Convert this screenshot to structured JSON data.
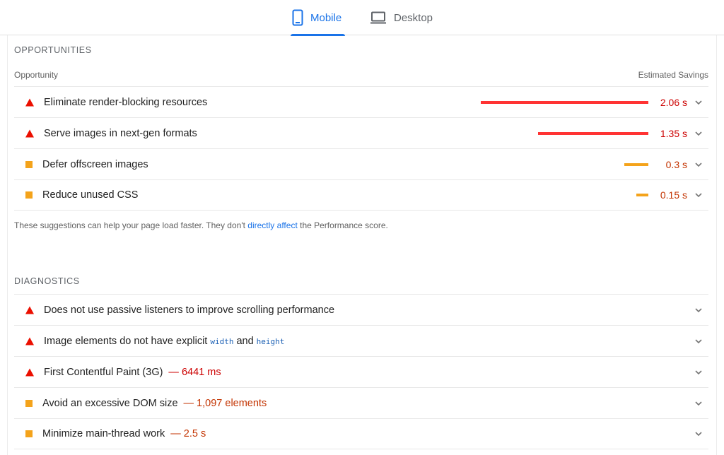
{
  "tabs": [
    {
      "label": "Mobile",
      "icon": "smartphone-icon",
      "active": true
    },
    {
      "label": "Desktop",
      "icon": "laptop-icon",
      "active": false
    }
  ],
  "colors": {
    "accent": "#1a73e8",
    "fail": "#eb0f00",
    "average": "#f4a31b",
    "fail_text": "#cc0000",
    "average_text": "#c33300"
  },
  "opportunities": {
    "title": "OPPORTUNITIES",
    "col_left": "Opportunity",
    "col_right": "Estimated Savings",
    "items": [
      {
        "title": "Eliminate render-blocking resources",
        "savings": "2.06 s",
        "savings_seconds": 2.06,
        "severity": "fail"
      },
      {
        "title": "Serve images in next-gen formats",
        "savings": "1.35 s",
        "savings_seconds": 1.35,
        "severity": "fail"
      },
      {
        "title": "Defer offscreen images",
        "savings": "0.3 s",
        "savings_seconds": 0.3,
        "severity": "average"
      },
      {
        "title": "Reduce unused CSS",
        "savings": "0.15 s",
        "savings_seconds": 0.15,
        "severity": "average"
      }
    ],
    "footnote_before": "These suggestions can help your page load faster. They don't ",
    "footnote_link": "directly affect",
    "footnote_after": " the Performance score."
  },
  "diagnostics": {
    "title": "DIAGNOSTICS",
    "items": [
      {
        "title": "Does not use passive listeners to improve scrolling performance",
        "severity": "fail"
      },
      {
        "title_before": "Image elements do not have explicit",
        "code1": "width",
        "title_mid": "and",
        "code2": "height",
        "severity": "fail"
      },
      {
        "title": "First Contentful Paint (3G)",
        "display_value": "— 6441 ms",
        "severity": "fail"
      },
      {
        "title": "Avoid an excessive DOM size",
        "display_value": "— 1,097 elements",
        "severity": "average"
      },
      {
        "title": "Minimize main-thread work",
        "display_value": "— 2.5 s",
        "severity": "average"
      }
    ]
  }
}
